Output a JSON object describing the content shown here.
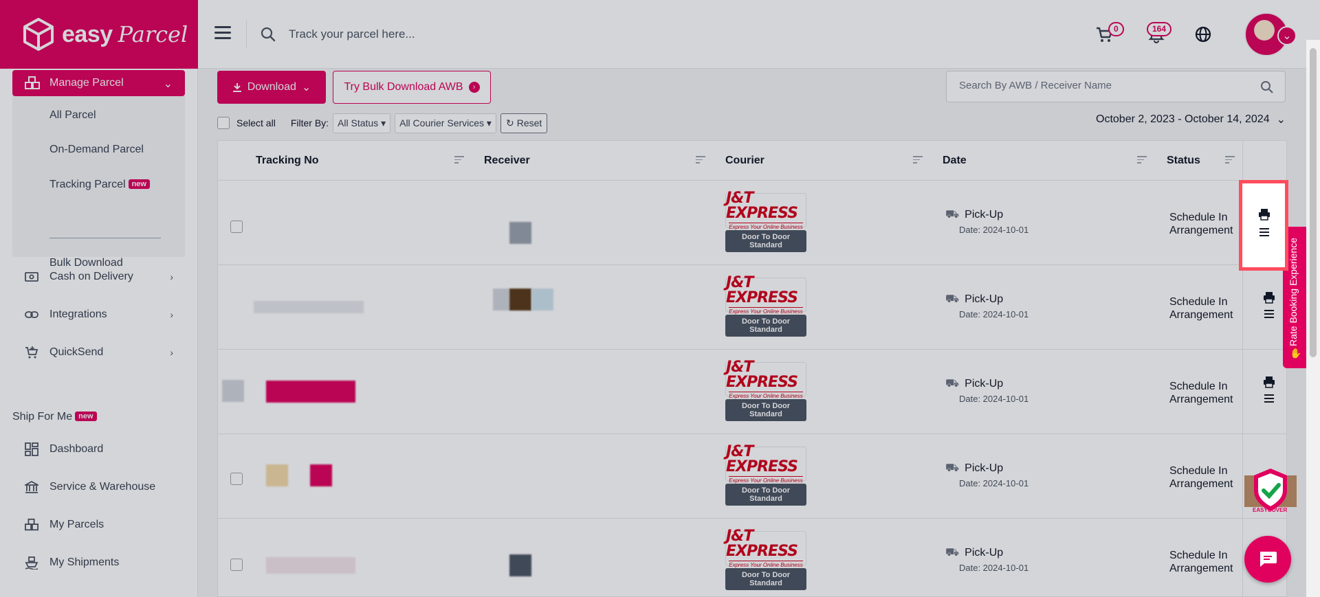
{
  "brand": {
    "name_easy": "easy",
    "name_parcel": "Parcel",
    "color": "#e0005e"
  },
  "topbar": {
    "search_placeholder": "Track your parcel here...",
    "cart_count": "0",
    "notification_count": "164"
  },
  "sidebar": {
    "manage_parcel": "Manage Parcel",
    "sub_items": [
      {
        "label": "All Parcel"
      },
      {
        "label": "On-Demand Parcel"
      },
      {
        "label": "Tracking Parcel",
        "badge": "new"
      },
      {
        "label": "Bulk Download"
      }
    ],
    "nav_items": [
      {
        "label": "Cash on Delivery",
        "icon": "cash-icon"
      },
      {
        "label": "Integrations",
        "icon": "link-icon"
      },
      {
        "label": "QuickSend",
        "icon": "cart-plus-icon"
      }
    ],
    "ship_for_me": {
      "label": "Ship For Me",
      "badge": "new"
    },
    "ship_items": [
      {
        "label": "Dashboard",
        "icon": "dashboard-icon"
      },
      {
        "label": "Service & Warehouse",
        "icon": "bank-icon"
      },
      {
        "label": "My Parcels",
        "icon": "boxes-icon"
      },
      {
        "label": "My Shipments",
        "icon": "ship-icon"
      }
    ]
  },
  "toolbar": {
    "download_label": "Download",
    "bulk_label": "Try Bulk Download AWB",
    "search_placeholder": "Search By AWB / Receiver Name",
    "select_all": "Select all",
    "filter_by": "Filter By:",
    "status_filter": "All Status",
    "courier_filter": "All Courier Services",
    "reset_label": "Reset",
    "date_range": "October 2, 2023 - October 14, 2024"
  },
  "table": {
    "headers": [
      "Tracking No",
      "Receiver",
      "Courier",
      "Date",
      "Status"
    ],
    "rows": [
      {
        "courier": "J&T EXPRESS",
        "courier_tagline": "Express Your Online Business",
        "service": "Door To Door Standard",
        "pickup": "Pick-Up",
        "date": "Date: 2024-10-01",
        "status": "Schedule In Arrangement"
      },
      {
        "courier": "J&T EXPRESS",
        "courier_tagline": "Express Your Online Business",
        "service": "Door To Door Standard",
        "pickup": "Pick-Up",
        "date": "Date: 2024-10-01",
        "status": "Schedule In Arrangement"
      },
      {
        "courier": "J&T EXPRESS",
        "courier_tagline": "Express Your Online Business",
        "service": "Door To Door Standard",
        "pickup": "Pick-Up",
        "date": "Date: 2024-10-01",
        "status": "Schedule In Arrangement"
      },
      {
        "courier": "J&T EXPRESS",
        "courier_tagline": "Express Your Online Business",
        "service": "Door To Door Standard",
        "pickup": "Pick-Up",
        "date": "Date: 2024-10-01",
        "status": "Schedule In Arrangement"
      },
      {
        "courier": "J&T EXPRESS",
        "courier_tagline": "Express Your Online Business",
        "service": "Door To Door Standard",
        "pickup": "Pick-Up",
        "date": "Date: 2024-10-01",
        "status": "Schedule In Arrangement"
      }
    ]
  },
  "floating": {
    "rate_tab": "Rate Booking Experience",
    "easycover": "EASYCOVER"
  }
}
